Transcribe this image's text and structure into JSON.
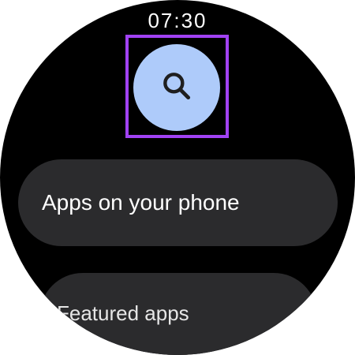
{
  "status_bar": {
    "time": "07:30"
  },
  "search": {
    "icon": "search-icon",
    "button_color": "#aecbfa",
    "focus_color": "#a142f4"
  },
  "list": {
    "items": [
      {
        "label": "Apps on your phone"
      },
      {
        "label": "Featured apps"
      }
    ]
  }
}
